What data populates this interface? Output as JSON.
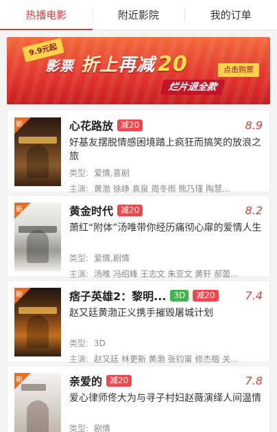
{
  "tabs": [
    {
      "label": "热播电影",
      "active": true
    },
    {
      "label": "附近影院",
      "active": false
    },
    {
      "label": "我的订单",
      "active": false
    }
  ],
  "banner": {
    "price_tag": "9.9元起",
    "headline_1": "影票",
    "headline_2": "折上",
    "headline_3": "再减",
    "headline_num": "20",
    "buy_button": "点击购票",
    "refund": "烂片退全款"
  },
  "labels": {
    "type": "类型:",
    "cast": "主演:",
    "new": "新"
  },
  "movies": [
    {
      "title": "心花路放",
      "tags": [
        {
          "text": "减20",
          "color": "red"
        }
      ],
      "score": "8.9",
      "desc": "好基友摆脱情感困境踏上疯狂而搞笑的放浪之旅",
      "genre": "爱情,喜剧",
      "cast": "黄渤 徐峥 袁泉 周冬雨 熊乃瑾 陶慧..."
    },
    {
      "title": "黄金时代",
      "tags": [
        {
          "text": "减20",
          "color": "red"
        }
      ],
      "score": "8.2",
      "desc": "萧红“附体”汤唯带你经历痛彻心扉的爱情人生",
      "genre": "爱情,剧情",
      "cast": "汤唯 冯绍峰 王志文 朱亚文 黄轩 郝蕾..."
    },
    {
      "title": "痞子英雄2：黎明...",
      "tags": [
        {
          "text": "3D",
          "color": "green"
        },
        {
          "text": "减20",
          "color": "red"
        }
      ],
      "score": "7.4",
      "desc": "赵又廷黄渤正义携手摧毁屠城计划",
      "genre": "3D",
      "cast": "赵又廷 林更新 黄渤 张钧甯 修杰楷 关..."
    },
    {
      "title": "亲爱的",
      "tags": [
        {
          "text": "减20",
          "color": "red"
        }
      ],
      "score": "7.8",
      "desc": "爱心律师佟大为与寻子村妇赵薇演绎人间温情",
      "genre": "剧情",
      "cast": ""
    }
  ]
}
